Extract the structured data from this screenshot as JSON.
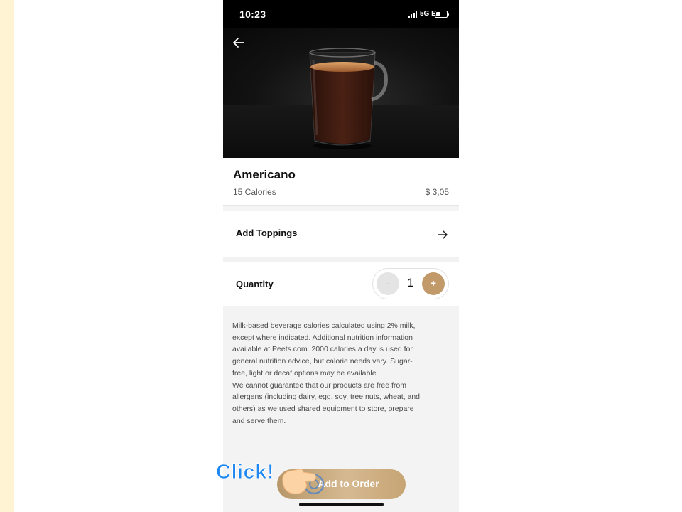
{
  "status_bar": {
    "time": "10:23",
    "network": "5G E"
  },
  "product": {
    "name": "Americano",
    "calories": "15 Calories",
    "price": "$ 3,05"
  },
  "toppings": {
    "label": "Add Toppings"
  },
  "quantity": {
    "label": "Quantity",
    "minus": "-",
    "value": "1",
    "plus": "+"
  },
  "disclaimer": "Milk-based beverage calories calculated using 2% milk,\nexcept where indicated. Additional nutrition information\navailable at Peets.com. 2000 calories a day is used for\ngeneral nutrition advice, but calorie needs vary.  Sugar-\nfree, light or decaf options may be available.\nWe cannot guarantee that our products are free from\nallergens (including dairy, egg, soy, tree nuts, wheat, and\nothers) as we used shared equipment to store, prepare\nand serve them.",
  "add_button": {
    "label": "Add to Order"
  },
  "overlay": {
    "click_text": "Click!"
  },
  "colors": {
    "accent": "#c29a6a",
    "click_text": "#1e88f2",
    "left_strip": "#fff3d4"
  },
  "icons": {
    "back": "arrow-left-icon",
    "toppings": "arrow-right-icon",
    "pointer": "hand-pointer-icon",
    "signal": "signal-icon",
    "battery": "battery-icon"
  }
}
